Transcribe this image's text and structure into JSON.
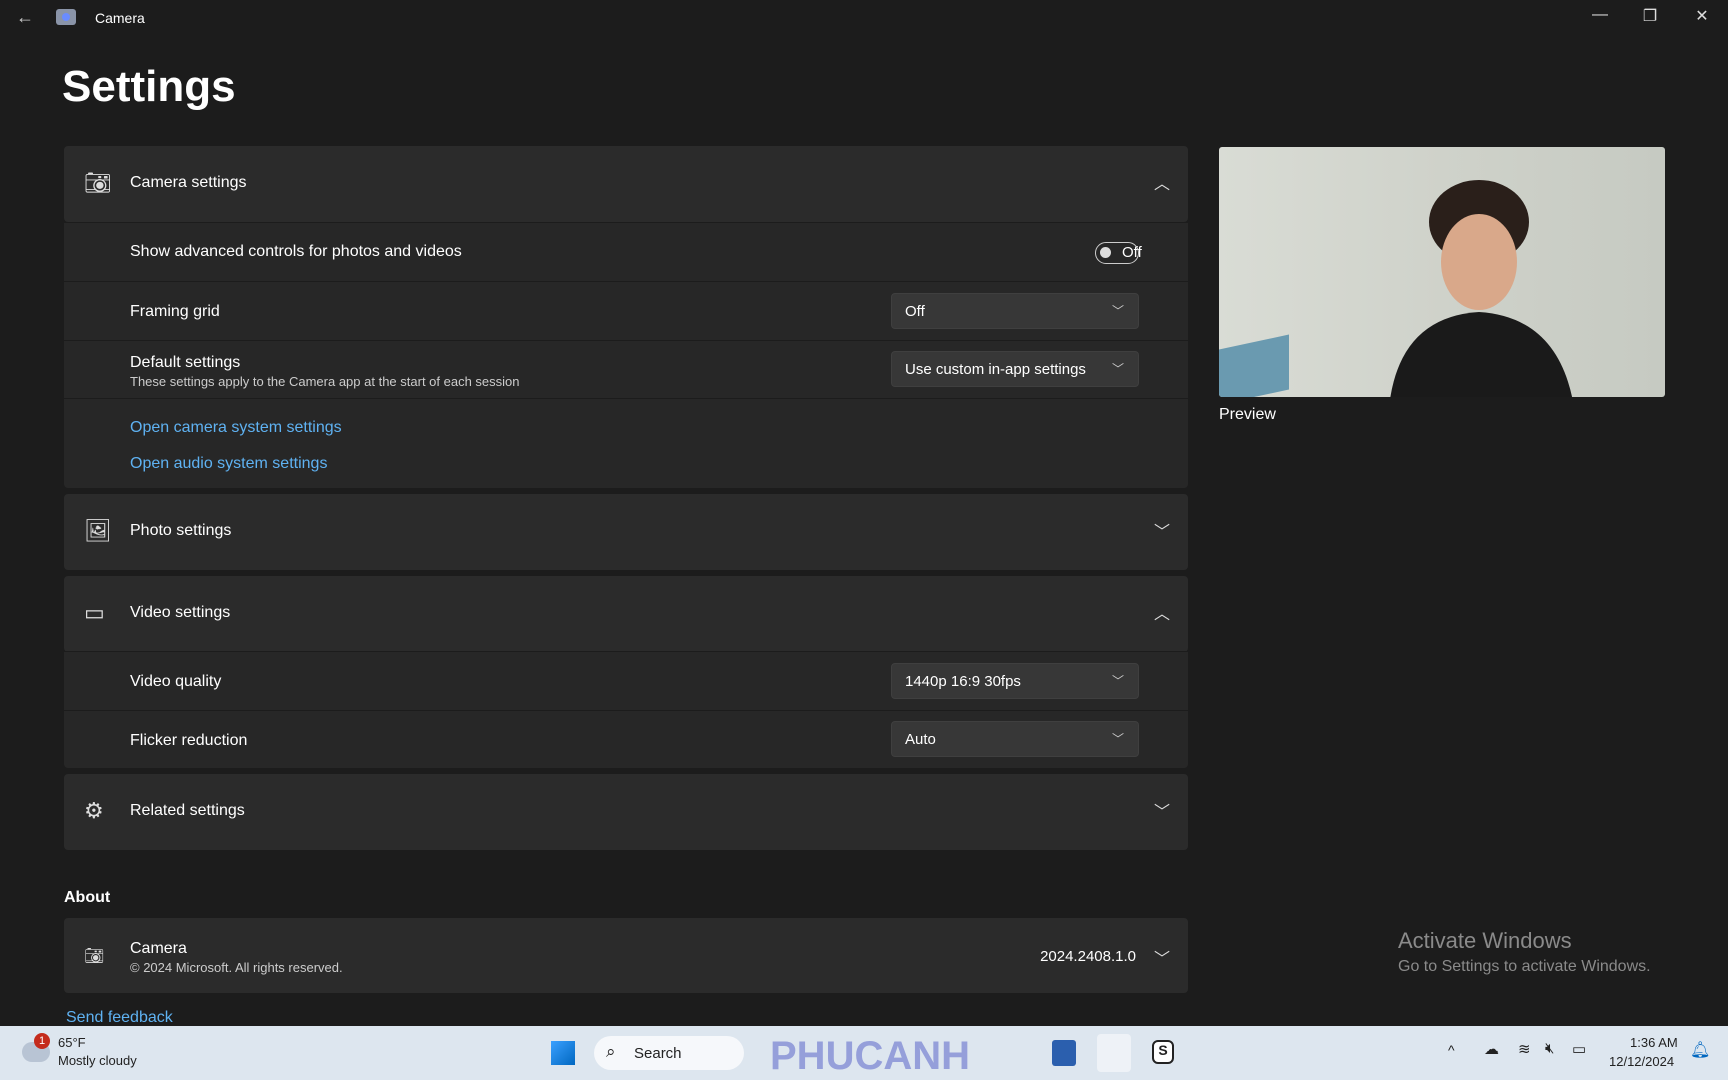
{
  "window": {
    "title": "Camera",
    "back": "←",
    "minimize": "—",
    "restore": "❐",
    "close": "✕"
  },
  "page_title": "Settings",
  "camera_settings": {
    "label": "Camera settings",
    "icon": "camera-icon",
    "expanded": true,
    "advanced": {
      "label": "Show advanced controls for photos and videos",
      "state": "Off",
      "on": false
    },
    "framing": {
      "label": "Framing grid",
      "value": "Off"
    },
    "defaults": {
      "label": "Default settings",
      "sub": "These settings apply to the Camera app at the start of each session",
      "value": "Use custom in-app settings"
    },
    "links": [
      "Open camera system settings",
      "Open audio system settings"
    ]
  },
  "photo_settings": {
    "label": "Photo settings",
    "icon": "image-icon",
    "expanded": false
  },
  "video_settings": {
    "label": "Video settings",
    "icon": "video-icon",
    "expanded": true,
    "quality": {
      "label": "Video quality",
      "value": "1440p 16:9 30fps"
    },
    "flicker": {
      "label": "Flicker reduction",
      "value": "Auto"
    }
  },
  "related": {
    "label": "Related settings",
    "icon": "gear-icon"
  },
  "about": {
    "heading": "About",
    "name": "Camera",
    "copyright": "© 2024 Microsoft. All rights reserved.",
    "version": "2024.2408.1.0"
  },
  "send_feedback": "Send feedback",
  "preview": {
    "label": "Preview"
  },
  "watermark": {
    "title": "Activate Windows",
    "sub": "Go to Settings to activate Windows."
  },
  "taskbar": {
    "weather_badge": "1",
    "temp": "65°F",
    "condition": "Mostly cloudy",
    "search": "Search",
    "time": "1:36 AM",
    "date": "12/12/2024",
    "logo_text": "PHUCANH"
  },
  "colors": {
    "accent_link": "#5fb2f2",
    "background": "#1c1c1c",
    "card": "#2b2b2b"
  }
}
